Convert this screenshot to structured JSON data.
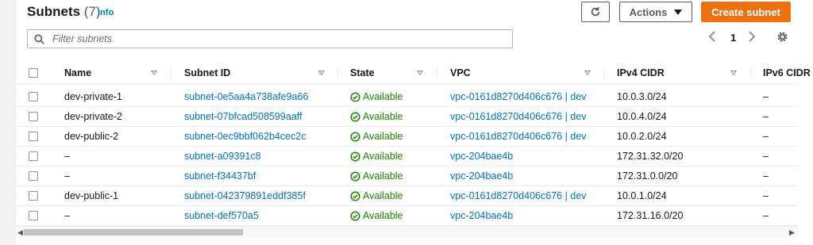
{
  "header": {
    "title": "Subnets",
    "count": "(7)",
    "info": "Info"
  },
  "toolbar": {
    "refresh_icon": "refresh-icon",
    "actions_label": "Actions",
    "create_label": "Create subnet"
  },
  "filter": {
    "placeholder": "Filter subnets",
    "value": ""
  },
  "pagination": {
    "current_page": "1"
  },
  "table": {
    "columns": [
      "Name",
      "Subnet ID",
      "State",
      "VPC",
      "IPv4 CIDR",
      "IPv6 CIDR"
    ],
    "rows": [
      {
        "name": "dev-private-1",
        "subnet_id": "subnet-0e5aa4a738afe9a66",
        "state": "Available",
        "vpc": "vpc-0161d8270d406c676 | dev",
        "ipv4": "10.0.3.0/24",
        "ipv6": "–"
      },
      {
        "name": "dev-private-2",
        "subnet_id": "subnet-07bfcad508599aaff",
        "state": "Available",
        "vpc": "vpc-0161d8270d406c676 | dev",
        "ipv4": "10.0.4.0/24",
        "ipv6": "–"
      },
      {
        "name": "dev-public-2",
        "subnet_id": "subnet-0ec9bbf062b4cec2c",
        "state": "Available",
        "vpc": "vpc-0161d8270d406c676 | dev",
        "ipv4": "10.0.2.0/24",
        "ipv6": "–"
      },
      {
        "name": "–",
        "subnet_id": "subnet-a09391c8",
        "state": "Available",
        "vpc": "vpc-204bae4b",
        "ipv4": "172.31.32.0/20",
        "ipv6": "–"
      },
      {
        "name": "–",
        "subnet_id": "subnet-f34437bf",
        "state": "Available",
        "vpc": "vpc-204bae4b",
        "ipv4": "172.31.0.0/20",
        "ipv6": "–"
      },
      {
        "name": "dev-public-1",
        "subnet_id": "subnet-042379891eddf385f",
        "state": "Available",
        "vpc": "vpc-0161d8270d406c676 | dev",
        "ipv4": "10.0.1.0/24",
        "ipv6": "–"
      },
      {
        "name": "–",
        "subnet_id": "subnet-def570a5",
        "state": "Available",
        "vpc": "vpc-204bae4b",
        "ipv4": "172.31.16.0/20",
        "ipv6": "–"
      }
    ]
  },
  "colors": {
    "accent": "#ec7211",
    "link": "#0073bb",
    "success": "#1d8102"
  }
}
